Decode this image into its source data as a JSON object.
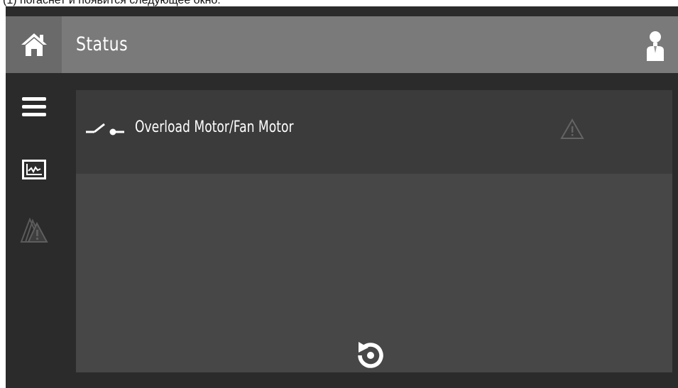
{
  "caption": {
    "text": "(1) погаснет и появится следующее окно:"
  },
  "header": {
    "title": "Status"
  },
  "sidebar": {
    "items": [
      "menu-icon",
      "trend-chart-icon",
      "alarms-icon"
    ]
  },
  "alarms": [
    {
      "label": "Overload Motor/Fan Motor",
      "icon": "switch-icon",
      "status_icon": "warning-triangle-icon"
    }
  ],
  "footer": {
    "action": "reset-icon"
  },
  "colors": {
    "topbar": "#7a7a7a",
    "home_tile": "#6a6a6a",
    "background": "#2b2b2b",
    "panel": "#474747",
    "alarm_row": "#3b3b3b",
    "text": "#ffffff"
  }
}
